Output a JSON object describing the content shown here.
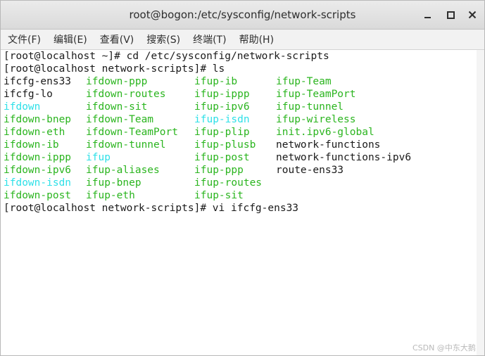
{
  "window": {
    "title": "root@bogon:/etc/sysconfig/network-scripts"
  },
  "menu": [
    "文件(F)",
    "编辑(E)",
    "查看(V)",
    "搜索(S)",
    "终端(T)",
    "帮助(H)"
  ],
  "terminal": {
    "prompt1": "[root@localhost ~]# cd /etc/sysconfig/network-scripts",
    "prompt2": "[root@localhost network-scripts]# ls",
    "listing": [
      [
        {
          "t": "ifcfg-ens33",
          "c": "black"
        },
        {
          "t": "ifdown-ppp",
          "c": "green"
        },
        {
          "t": "ifup-ib",
          "c": "green"
        },
        {
          "t": "ifup-Team",
          "c": "green"
        }
      ],
      [
        {
          "t": "ifcfg-lo",
          "c": "black"
        },
        {
          "t": "ifdown-routes",
          "c": "green"
        },
        {
          "t": "ifup-ippp",
          "c": "green"
        },
        {
          "t": "ifup-TeamPort",
          "c": "green"
        }
      ],
      [
        {
          "t": "ifdown",
          "c": "cyan"
        },
        {
          "t": "ifdown-sit",
          "c": "green"
        },
        {
          "t": "ifup-ipv6",
          "c": "green"
        },
        {
          "t": "ifup-tunnel",
          "c": "green"
        }
      ],
      [
        {
          "t": "ifdown-bnep",
          "c": "green"
        },
        {
          "t": "ifdown-Team",
          "c": "green"
        },
        {
          "t": "ifup-isdn",
          "c": "cyan"
        },
        {
          "t": "ifup-wireless",
          "c": "green"
        }
      ],
      [
        {
          "t": "ifdown-eth",
          "c": "green"
        },
        {
          "t": "ifdown-TeamPort",
          "c": "green"
        },
        {
          "t": "ifup-plip",
          "c": "green"
        },
        {
          "t": "init.ipv6-global",
          "c": "green"
        }
      ],
      [
        {
          "t": "ifdown-ib",
          "c": "green"
        },
        {
          "t": "ifdown-tunnel",
          "c": "green"
        },
        {
          "t": "ifup-plusb",
          "c": "green"
        },
        {
          "t": "network-functions",
          "c": "black"
        }
      ],
      [
        {
          "t": "ifdown-ippp",
          "c": "green"
        },
        {
          "t": "ifup",
          "c": "cyan"
        },
        {
          "t": "ifup-post",
          "c": "green"
        },
        {
          "t": "network-functions-ipv6",
          "c": "black"
        }
      ],
      [
        {
          "t": "ifdown-ipv6",
          "c": "green"
        },
        {
          "t": "ifup-aliases",
          "c": "green"
        },
        {
          "t": "ifup-ppp",
          "c": "green"
        },
        {
          "t": "route-ens33",
          "c": "black"
        }
      ],
      [
        {
          "t": "ifdown-isdn",
          "c": "cyan"
        },
        {
          "t": "ifup-bnep",
          "c": "green"
        },
        {
          "t": "ifup-routes",
          "c": "green"
        },
        {
          "t": "",
          "c": "black"
        }
      ],
      [
        {
          "t": "ifdown-post",
          "c": "green"
        },
        {
          "t": "ifup-eth",
          "c": "green"
        },
        {
          "t": "ifup-sit",
          "c": "green"
        },
        {
          "t": "",
          "c": "black"
        }
      ]
    ],
    "prompt3": "[root@localhost network-scripts]# vi ifcfg-ens33"
  },
  "colors": {
    "executable": "#2bb51f",
    "symlink": "#2ee0e8",
    "regular": "#1a1a1a"
  },
  "watermark": "CSDN @中东大鹅"
}
